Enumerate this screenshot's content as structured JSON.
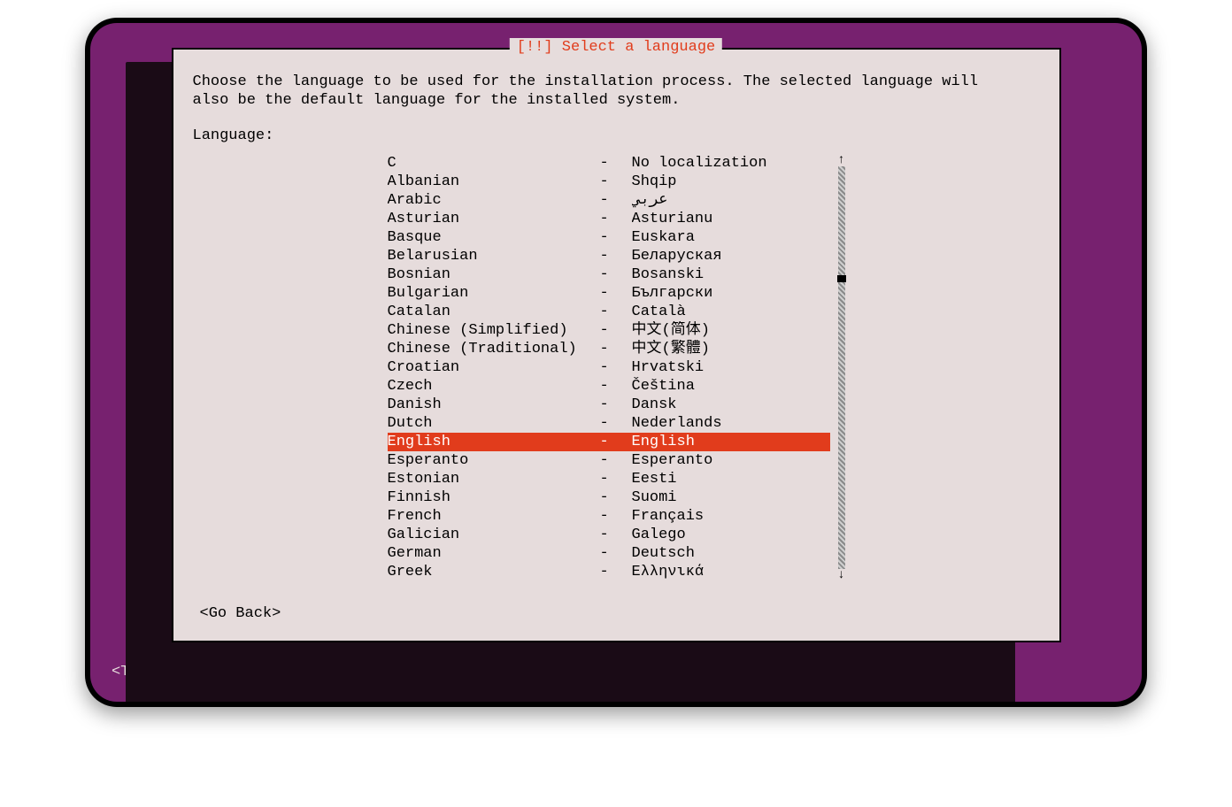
{
  "dialog": {
    "title": "[!!] Select a language",
    "description": "Choose the language to be used for the installation process. The selected language will\nalso be the default language for the installed system.",
    "label": "Language:",
    "go_back": "<Go Back>"
  },
  "languages": [
    {
      "english": "C",
      "native": "No localization",
      "selected": false
    },
    {
      "english": "Albanian",
      "native": "Shqip",
      "selected": false
    },
    {
      "english": "Arabic",
      "native": "عربي",
      "selected": false
    },
    {
      "english": "Asturian",
      "native": "Asturianu",
      "selected": false
    },
    {
      "english": "Basque",
      "native": "Euskara",
      "selected": false
    },
    {
      "english": "Belarusian",
      "native": "Беларуская",
      "selected": false
    },
    {
      "english": "Bosnian",
      "native": "Bosanski",
      "selected": false
    },
    {
      "english": "Bulgarian",
      "native": "Български",
      "selected": false
    },
    {
      "english": "Catalan",
      "native": "Català",
      "selected": false
    },
    {
      "english": "Chinese (Simplified)",
      "native": "中文(简体)",
      "selected": false
    },
    {
      "english": "Chinese (Traditional)",
      "native": "中文(繁體)",
      "selected": false
    },
    {
      "english": "Croatian",
      "native": "Hrvatski",
      "selected": false
    },
    {
      "english": "Czech",
      "native": "Čeština",
      "selected": false
    },
    {
      "english": "Danish",
      "native": "Dansk",
      "selected": false
    },
    {
      "english": "Dutch",
      "native": "Nederlands",
      "selected": false
    },
    {
      "english": "English",
      "native": "English",
      "selected": true
    },
    {
      "english": "Esperanto",
      "native": "Esperanto",
      "selected": false
    },
    {
      "english": "Estonian",
      "native": "Eesti",
      "selected": false
    },
    {
      "english": "Finnish",
      "native": "Suomi",
      "selected": false
    },
    {
      "english": "French",
      "native": "Français",
      "selected": false
    },
    {
      "english": "Galician",
      "native": "Galego",
      "selected": false
    },
    {
      "english": "German",
      "native": "Deutsch",
      "selected": false
    },
    {
      "english": "Greek",
      "native": "Ελληνικά",
      "selected": false
    }
  ],
  "scrollbar": {
    "thumb_position_percent": 27
  },
  "help": "<Tab> moves; <Space> selects; <Enter> activates buttons"
}
